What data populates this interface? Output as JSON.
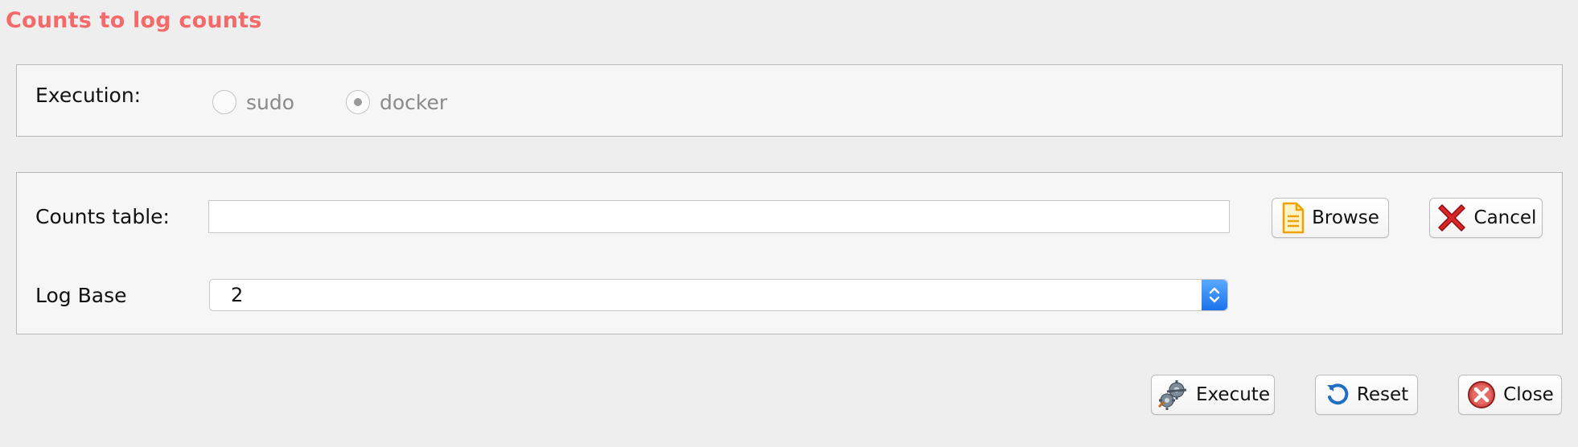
{
  "window_title": "Counts to log counts",
  "execution": {
    "label": "Execution:",
    "options": [
      {
        "label": "sudo",
        "selected": false
      },
      {
        "label": "docker",
        "selected": true
      }
    ]
  },
  "form": {
    "counts_table": {
      "label": "Counts table:",
      "value": "",
      "browse_label": "Browse",
      "cancel_label": "Cancel"
    },
    "log_base": {
      "label": "Log Base",
      "value": "2"
    }
  },
  "actions": {
    "execute_label": "Execute",
    "reset_label": "Reset",
    "close_label": "Close"
  },
  "colors": {
    "title": "#f46a6a",
    "select_arrow": "#1a73ec"
  },
  "icons": {
    "browse": "document-icon",
    "cancel": "red-x-icon",
    "execute": "gears-icon",
    "reset": "refresh-icon",
    "close": "close-circle-icon"
  }
}
